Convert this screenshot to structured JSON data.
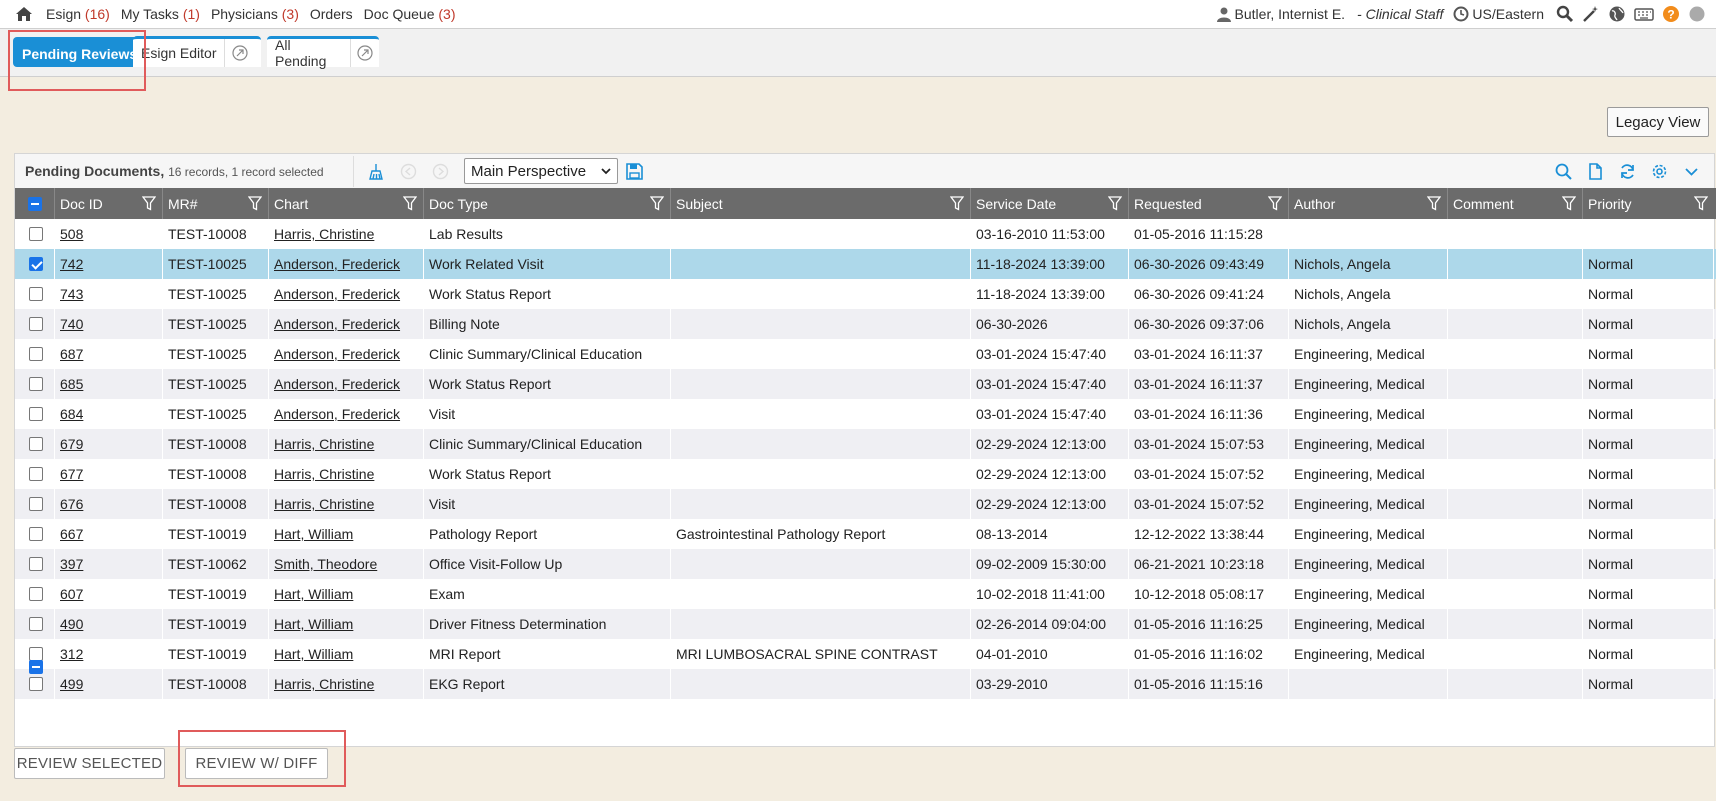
{
  "nav": {
    "items": [
      {
        "label": "Esign",
        "count": "(16)"
      },
      {
        "label": "My Tasks",
        "count": "(1)"
      },
      {
        "label": "Physicians",
        "count": "(3)"
      },
      {
        "label": "Orders",
        "count": ""
      },
      {
        "label": "Doc Queue",
        "count": "(3)"
      }
    ],
    "user": "Butler, Internist E.",
    "role": "- Clinical Staff",
    "timezone": "US/Eastern"
  },
  "tabs": {
    "pending_reviews": "Pending Reviews",
    "esign_editor": "Esign Editor",
    "all_pending": "All Pending"
  },
  "legacy_view": "Legacy View",
  "toolbar": {
    "title": "Pending Documents,",
    "subtitle": "16 records, 1 record selected",
    "perspective": "Main Perspective"
  },
  "columns": [
    "Doc ID",
    "MR#",
    "Chart",
    "Doc Type",
    "Subject",
    "Service Date",
    "Requested",
    "Author",
    "Comment",
    "Priority"
  ],
  "rows": [
    {
      "id": "508",
      "mr": "TEST-10008",
      "chart": "Harris, Christine",
      "type": "Lab Results",
      "subject": "",
      "service": "03-16-2010 11:53:00",
      "requested": "01-05-2016 11:15:28",
      "author": "",
      "comment": "",
      "priority": "",
      "checked": false
    },
    {
      "id": "742",
      "mr": "TEST-10025",
      "chart": "Anderson, Frederick",
      "type": "Work Related Visit",
      "subject": "",
      "service": "11-18-2024 13:39:00",
      "requested": "06-30-2026 09:43:49",
      "author": "Nichols, Angela",
      "comment": "",
      "priority": "Normal",
      "checked": true
    },
    {
      "id": "743",
      "mr": "TEST-10025",
      "chart": "Anderson, Frederick",
      "type": "Work Status Report",
      "subject": "",
      "service": "11-18-2024 13:39:00",
      "requested": "06-30-2026 09:41:24",
      "author": "Nichols, Angela",
      "comment": "",
      "priority": "Normal",
      "checked": false
    },
    {
      "id": "740",
      "mr": "TEST-10025",
      "chart": "Anderson, Frederick",
      "type": "Billing Note",
      "subject": "",
      "service": "06-30-2026",
      "requested": "06-30-2026 09:37:06",
      "author": "Nichols, Angela",
      "comment": "",
      "priority": "Normal",
      "checked": false
    },
    {
      "id": "687",
      "mr": "TEST-10025",
      "chart": "Anderson, Frederick",
      "type": "Clinic Summary/Clinical Education",
      "subject": "",
      "service": "03-01-2024 15:47:40",
      "requested": "03-01-2024 16:11:37",
      "author": "Engineering, Medical",
      "comment": "",
      "priority": "Normal",
      "checked": false
    },
    {
      "id": "685",
      "mr": "TEST-10025",
      "chart": "Anderson, Frederick",
      "type": "Work Status Report",
      "subject": "",
      "service": "03-01-2024 15:47:40",
      "requested": "03-01-2024 16:11:37",
      "author": "Engineering, Medical",
      "comment": "",
      "priority": "Normal",
      "checked": false
    },
    {
      "id": "684",
      "mr": "TEST-10025",
      "chart": "Anderson, Frederick",
      "type": "Visit",
      "subject": "",
      "service": "03-01-2024 15:47:40",
      "requested": "03-01-2024 16:11:36",
      "author": "Engineering, Medical",
      "comment": "",
      "priority": "Normal",
      "checked": false
    },
    {
      "id": "679",
      "mr": "TEST-10008",
      "chart": "Harris, Christine",
      "type": "Clinic Summary/Clinical Education",
      "subject": "",
      "service": "02-29-2024 12:13:00",
      "requested": "03-01-2024 15:07:53",
      "author": "Engineering, Medical",
      "comment": "",
      "priority": "Normal",
      "checked": false
    },
    {
      "id": "677",
      "mr": "TEST-10008",
      "chart": "Harris, Christine",
      "type": "Work Status Report",
      "subject": "",
      "service": "02-29-2024 12:13:00",
      "requested": "03-01-2024 15:07:52",
      "author": "Engineering, Medical",
      "comment": "",
      "priority": "Normal",
      "checked": false
    },
    {
      "id": "676",
      "mr": "TEST-10008",
      "chart": "Harris, Christine",
      "type": "Visit",
      "subject": "",
      "service": "02-29-2024 12:13:00",
      "requested": "03-01-2024 15:07:52",
      "author": "Engineering, Medical",
      "comment": "",
      "priority": "Normal",
      "checked": false
    },
    {
      "id": "667",
      "mr": "TEST-10019",
      "chart": "Hart, William",
      "type": "Pathology Report",
      "subject": "Gastrointestinal Pathology Report",
      "service": "08-13-2014",
      "requested": "12-12-2022 13:38:44",
      "author": "Engineering, Medical",
      "comment": "",
      "priority": "Normal",
      "checked": false
    },
    {
      "id": "397",
      "mr": "TEST-10062",
      "chart": "Smith, Theodore",
      "type": "Office Visit-Follow Up",
      "subject": "",
      "service": "09-02-2009 15:30:00",
      "requested": "06-21-2021 10:23:18",
      "author": "Engineering, Medical",
      "comment": "",
      "priority": "Normal",
      "checked": false
    },
    {
      "id": "607",
      "mr": "TEST-10019",
      "chart": "Hart, William",
      "type": "Exam",
      "subject": "",
      "service": "10-02-2018 11:41:00",
      "requested": "10-12-2018 05:08:17",
      "author": "Engineering, Medical",
      "comment": "",
      "priority": "Normal",
      "checked": false
    },
    {
      "id": "490",
      "mr": "TEST-10019",
      "chart": "Hart, William",
      "type": "Driver Fitness Determination",
      "subject": "",
      "service": "02-26-2014 09:04:00",
      "requested": "01-05-2016 11:16:25",
      "author": "Engineering, Medical",
      "comment": "",
      "priority": "Normal",
      "checked": false
    },
    {
      "id": "312",
      "mr": "TEST-10019",
      "chart": "Hart, William",
      "type": "MRI Report",
      "subject": "MRI LUMBOSACRAL SPINE CONTRAST",
      "service": "04-01-2010",
      "requested": "01-05-2016 11:16:02",
      "author": "Engineering, Medical",
      "comment": "",
      "priority": "Normal",
      "checked": false
    },
    {
      "id": "499",
      "mr": "TEST-10008",
      "chart": "Harris, Christine",
      "type": "EKG Report",
      "subject": "",
      "service": "03-29-2010",
      "requested": "01-05-2016 11:15:16",
      "author": "",
      "comment": "",
      "priority": "Normal",
      "checked": false
    }
  ],
  "buttons": {
    "review_selected": "REVIEW SELECTED",
    "review_diff": "REVIEW W/ DIFF"
  }
}
